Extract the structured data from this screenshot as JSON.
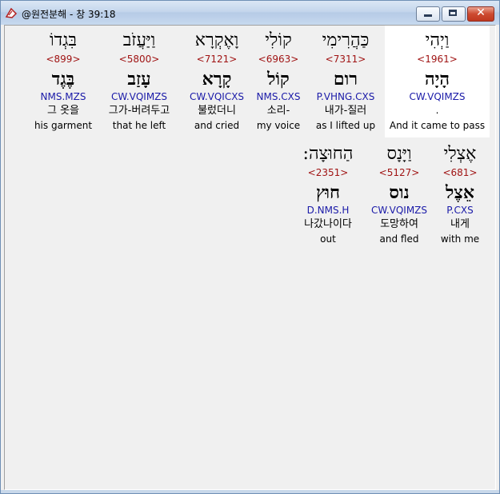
{
  "window": {
    "title": "@원전분해 - 창 39:18",
    "controls": {
      "minimize": "",
      "maximize": "",
      "close": "✕"
    }
  },
  "words": [
    {
      "hebrew": "וַיְהִי",
      "strong": "<1961>",
      "lemma": "הָיָה",
      "parse": "CW.VQIMZS",
      "korean": ".",
      "english": "And it came to pass",
      "selected": true
    },
    {
      "hebrew": "כַּהֲרִימִי",
      "strong": "<7311>",
      "lemma": "רום",
      "parse": "P.VHNG.CXS",
      "korean": "내가-질러",
      "english": "as I lifted up"
    },
    {
      "hebrew": "קוֹלִי",
      "strong": "<6963>",
      "lemma": "קוֹל",
      "parse": "NMS.CXS",
      "korean": "소리-",
      "english": "my voice"
    },
    {
      "hebrew": "וָאֶקְרָא",
      "strong": "<7121>",
      "lemma": "קָרָא",
      "parse": "CW.VQICXS",
      "korean": "불렀더니",
      "english": "and cried"
    },
    {
      "hebrew": "וַיַּעֲזֹב",
      "strong": "<5800>",
      "lemma": "עָזַב",
      "parse": "CW.VQIMZS",
      "korean": "그가-버려두고",
      "english": "that he left"
    },
    {
      "hebrew": "בִּגְדוֹ",
      "strong": "<899>",
      "lemma": "בֶּגֶד",
      "parse": "NMS.MZS",
      "korean": "그 옷을",
      "english": "his garment"
    },
    {
      "hebrew": "אֶצְלִי",
      "strong": "<681>",
      "lemma": "אֵצֶל",
      "parse": "P.CXS",
      "korean": "내게",
      "english": "with me"
    },
    {
      "hebrew": "וַיָּנָס",
      "strong": "<5127>",
      "lemma": "נוס",
      "parse": "CW.VQIMZS",
      "korean": "도망하여",
      "english": "and fled"
    },
    {
      "hebrew": "הַחוּצָה:",
      "strong": "<2351>",
      "lemma": "חוּץ",
      "parse": "D.NMS.H",
      "korean": "나갔나이다",
      "english": "out"
    }
  ]
}
